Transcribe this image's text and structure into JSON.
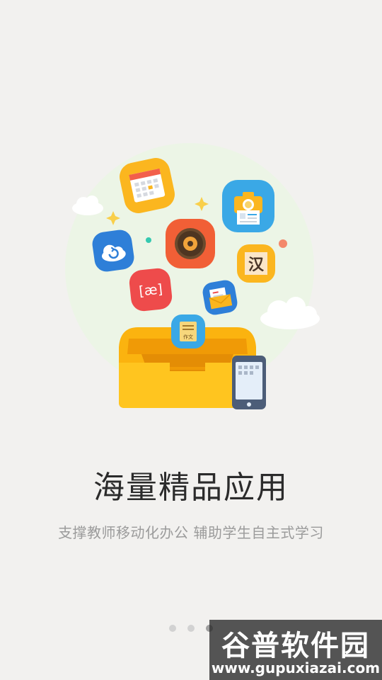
{
  "onboarding": {
    "title": "海量精品应用",
    "subtitle": "支撑教师移动化办公 辅助学生自主式学习",
    "page_indicator": {
      "total": 3,
      "active": 3
    },
    "illustration": {
      "icons": [
        "calendar-icon",
        "camera-icon",
        "cloud-sync-icon",
        "music-disc-icon",
        "chinese-character-icon",
        "phonetic-icon",
        "mail-icon",
        "essay-book-icon",
        "phone-icon"
      ],
      "hanzi_tile": "汉",
      "phonetic_tile": "[æ]",
      "essay_tile": "作文"
    }
  },
  "watermark": {
    "name": "谷普软件园",
    "url": "www.gupuxiazai.com"
  },
  "colors": {
    "background": "#f2f1ef",
    "circle": "#ecf5e6",
    "tray": "#fbb30f",
    "title": "#2b2b2b",
    "subtitle": "#9b9b9b"
  }
}
